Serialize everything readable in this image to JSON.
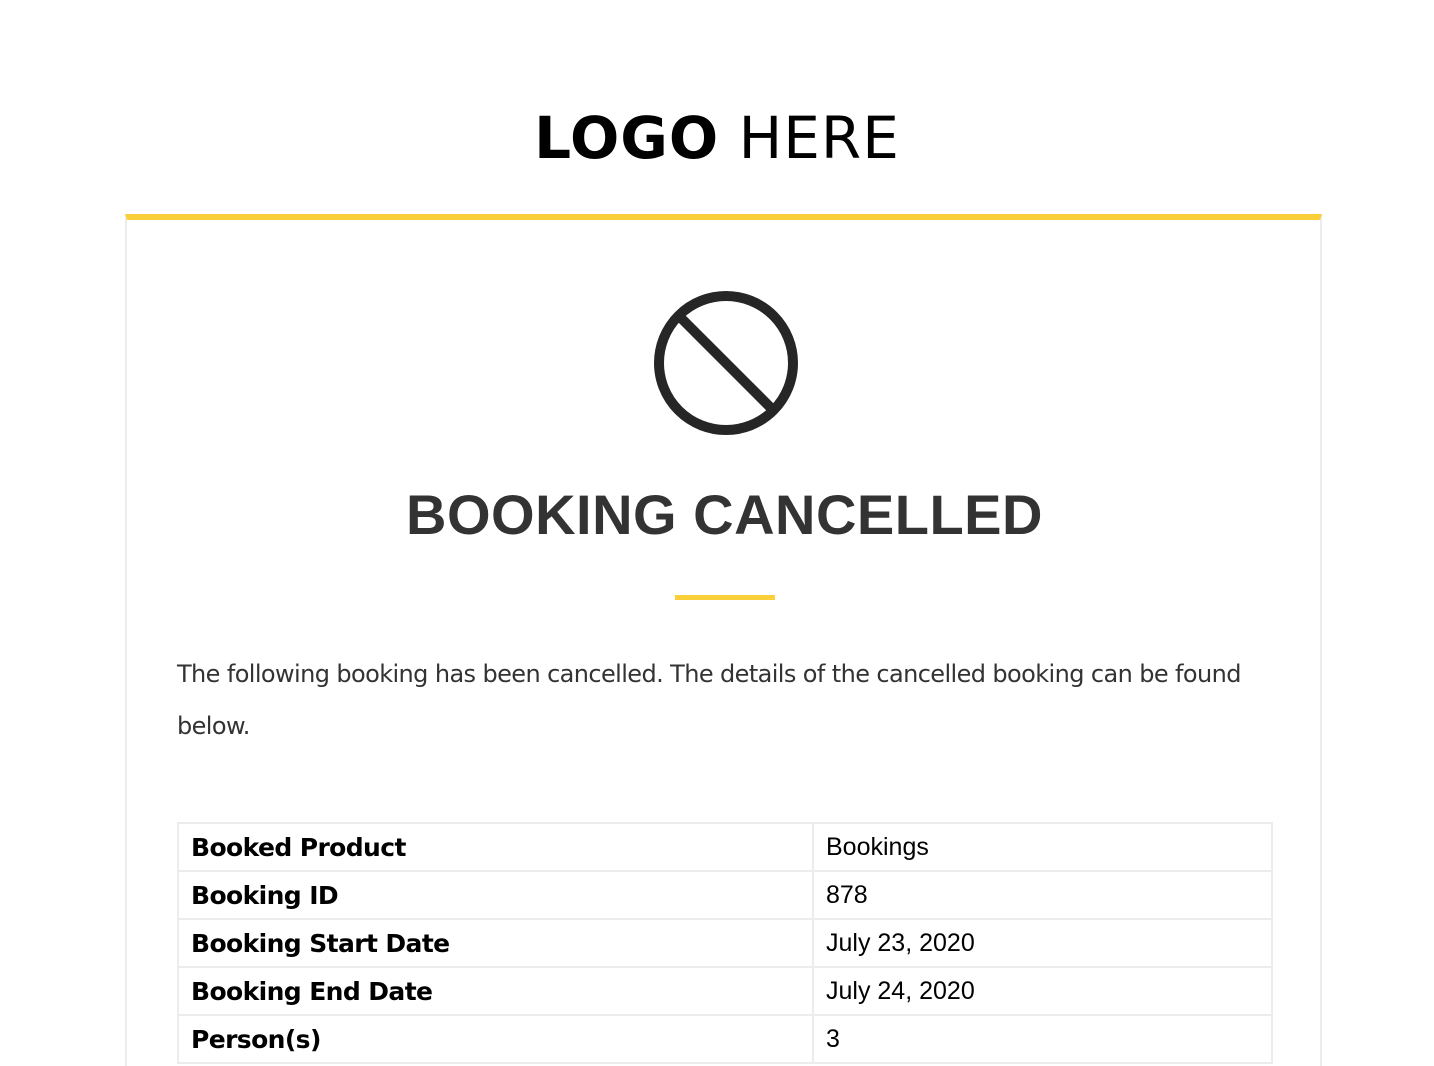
{
  "header": {
    "logo_bold": "LOGO",
    "logo_light": "HERE"
  },
  "colors": {
    "accent": "#fbcf3a",
    "text": "#333333",
    "border": "#ececec"
  },
  "status": {
    "icon": "prohibited-icon",
    "title": "BOOKING CANCELLED",
    "message": "The following booking has been cancelled. The details of the cancelled booking can be found below."
  },
  "details": {
    "rows": [
      {
        "label": "Booked Product",
        "value": "Bookings"
      },
      {
        "label": "Booking ID",
        "value": "878"
      },
      {
        "label": "Booking Start Date",
        "value": "July 23, 2020"
      },
      {
        "label": "Booking End Date",
        "value": "July 24, 2020"
      },
      {
        "label": "Person(s)",
        "value": "3"
      }
    ]
  }
}
